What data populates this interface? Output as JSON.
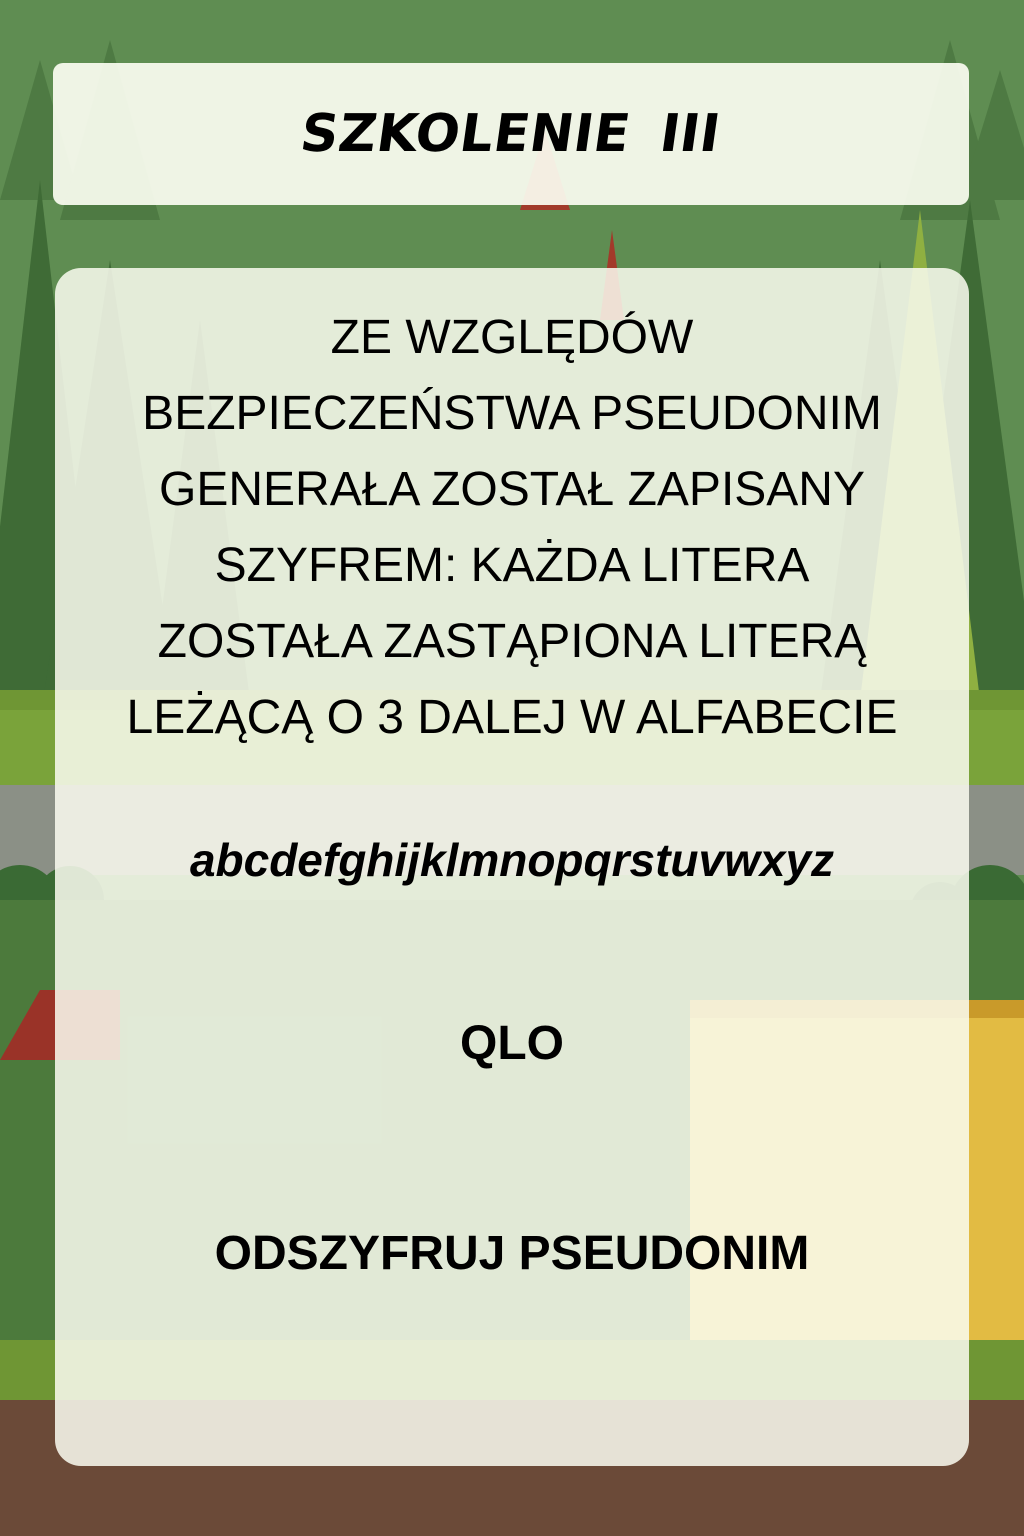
{
  "header": {
    "title": "SZKOLENIE  III"
  },
  "content": {
    "instruction": "ZE WZGLĘDÓW\nBEZPIECZEŃSTWA PSEUDONIM\nGENERAŁA ZOSTAŁ ZAPISANY\nSZYFREM: KAŻDA LITERA\nZOSTAŁA ZASTĄPIONA LITERĄ\nLEŻĄCĄ O 3 DALEJ W ALFABECIE",
    "alphabet": "abcdefghijklmnopqrstuvwxyz",
    "cipher_text": "QLO",
    "task": "ODSZYFRUJ PSEUDONIM"
  },
  "colors": {
    "forest": "#5d8a4c",
    "grass": "#7aa33a",
    "road": "#8a8f85",
    "ground": "#6b4a38",
    "panel": "#fafcf0"
  }
}
